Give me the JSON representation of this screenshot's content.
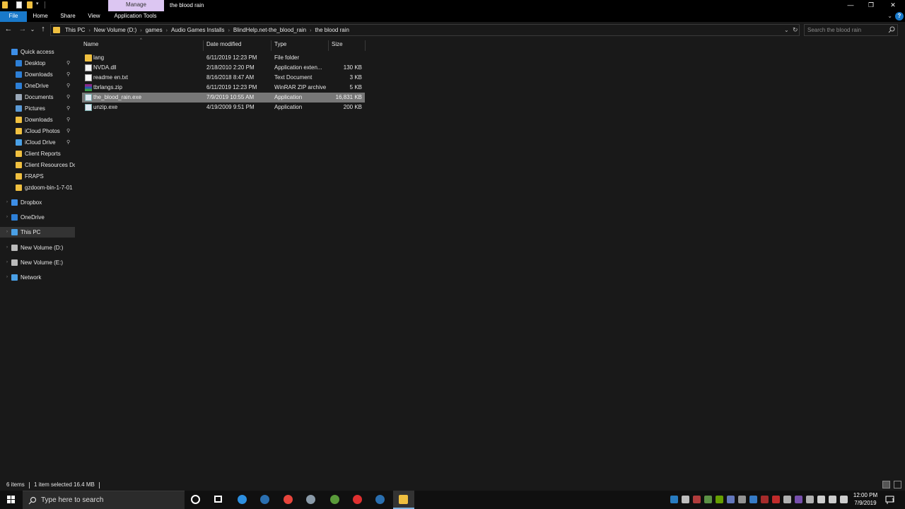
{
  "titlebar": {
    "manage_tab": "Manage",
    "title": "the blood rain",
    "minimize": "—",
    "restore": "❐",
    "close": "✕"
  },
  "ribbon": {
    "tabs": [
      "File",
      "Home",
      "Share",
      "View",
      "Application Tools"
    ],
    "help": "?",
    "collapse": "⌄"
  },
  "nav": {
    "back": "←",
    "forward": "→",
    "recent": "⌄",
    "up": "↑",
    "breadcrumbs": [
      "This PC",
      "New Volume (D:)",
      "games",
      "Audio Games Installs",
      "BlindHelp.net-the_blood_rain",
      "the blood rain"
    ],
    "crumb_sep": "›",
    "dropdown": "⌄",
    "refresh": "↻"
  },
  "search": {
    "placeholder": "Search the blood rain"
  },
  "sidebar": {
    "items": [
      {
        "label": "Quick access",
        "icon": "star-icon",
        "color": "#3d8ee6",
        "pinned": false
      },
      {
        "label": "Desktop",
        "icon": "desktop-icon",
        "color": "#2d7fd6",
        "pinned": true
      },
      {
        "label": "Downloads",
        "icon": "download-icon",
        "color": "#2d7fd6",
        "pinned": true
      },
      {
        "label": "OneDrive",
        "icon": "cloud-icon",
        "color": "#2d7fd6",
        "pinned": true
      },
      {
        "label": "Documents",
        "icon": "documents-icon",
        "color": "#9aa8b8",
        "pinned": true
      },
      {
        "label": "Pictures",
        "icon": "pictures-icon",
        "color": "#5a9ad6",
        "pinned": true
      },
      {
        "label": "Downloads",
        "icon": "folder-icon",
        "color": "#f0c040",
        "pinned": true
      },
      {
        "label": "iCloud Photos",
        "icon": "folder-icon",
        "color": "#f0c040",
        "pinned": true
      },
      {
        "label": "iCloud Drive",
        "icon": "icloud-icon",
        "color": "#4aa0e6",
        "pinned": true
      },
      {
        "label": "Client Reports",
        "icon": "folder-icon",
        "color": "#f0c040",
        "pinned": false
      },
      {
        "label": "Client Resources Dc",
        "icon": "folder-icon",
        "color": "#f0c040",
        "pinned": false
      },
      {
        "label": "FRAPS",
        "icon": "folder-icon",
        "color": "#f0c040",
        "pinned": false
      },
      {
        "label": "gzdoom-bin-1-7-01",
        "icon": "folder-icon",
        "color": "#f0c040",
        "pinned": false
      },
      {
        "label": "Dropbox",
        "icon": "dropbox-icon",
        "color": "#3d8ee6",
        "pinned": false
      },
      {
        "label": "OneDrive",
        "icon": "cloud-icon",
        "color": "#2d7fd6",
        "pinned": false
      },
      {
        "label": "This PC",
        "icon": "computer-icon",
        "color": "#4aa0e6",
        "pinned": false
      },
      {
        "label": "New Volume (D:)",
        "icon": "drive-icon",
        "color": "#bbbbbb",
        "pinned": false
      },
      {
        "label": "New Volume (E:)",
        "icon": "drive-icon",
        "color": "#bbbbbb",
        "pinned": false
      },
      {
        "label": "Network",
        "icon": "network-icon",
        "color": "#4aa0e6",
        "pinned": false
      }
    ],
    "pin_glyph": "📌",
    "caret_glyph": "›"
  },
  "files": {
    "headers": [
      "Name",
      "Date modified",
      "Type",
      "Size"
    ],
    "sort_indicator": "^",
    "rows": [
      {
        "name": "lang",
        "date": "6/11/2019 12:23 PM",
        "type": "File folder",
        "size": "",
        "icon": "folder-icon",
        "selected": false
      },
      {
        "name": "NVDA.dll",
        "date": "2/18/2010 2:20 PM",
        "type": "Application exten...",
        "size": "130 KB",
        "icon": "dll-file-icon",
        "selected": false
      },
      {
        "name": "readme en.txt",
        "date": "8/16/2018 8:47 AM",
        "type": "Text Document",
        "size": "3 KB",
        "icon": "text-file-icon",
        "selected": false
      },
      {
        "name": "tbrlangs.zip",
        "date": "6/11/2019 12:23 PM",
        "type": "WinRAR ZIP archive",
        "size": "5 KB",
        "icon": "zip-archive-icon",
        "selected": false
      },
      {
        "name": "the_blood_rain.exe",
        "date": "7/9/2019 10:55 AM",
        "type": "Application",
        "size": "16,831 KB",
        "icon": "application-icon",
        "selected": true
      },
      {
        "name": "unzip.exe",
        "date": "4/19/2009 9:51 PM",
        "type": "Application",
        "size": "200 KB",
        "icon": "application-icon",
        "selected": false
      }
    ]
  },
  "status": {
    "item_count": "6 items",
    "selection": "1 item selected  16.4 MB"
  },
  "taskbar": {
    "search_placeholder": "Type here to search",
    "apps": [
      "cortana-icon",
      "task-view-icon",
      "edge-icon",
      "steam-icon",
      "chrome-icon",
      "shield-app-icon",
      "minecraft-icon",
      "recorder-icon",
      "steam-icon",
      "file-explorer-icon"
    ],
    "clock_time": "12:00 PM",
    "clock_date": "7/9/2019",
    "notification_badge": "1"
  }
}
